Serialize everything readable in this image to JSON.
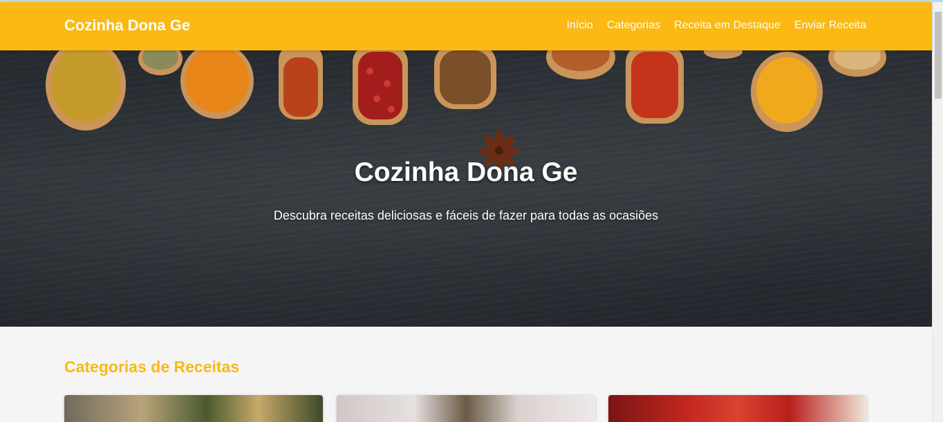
{
  "header": {
    "brand": "Cozinha Dona Ge",
    "nav": [
      "Início",
      "Categorias",
      "Receita em Destaque",
      "Enviar Receita"
    ]
  },
  "hero": {
    "title": "Cozinha Dona Ge",
    "subtitle": "Descubra receitas deliciosas e fáceis de fazer para todas as ocasiões"
  },
  "categories": {
    "title": "Categorias de Receitas"
  },
  "colors": {
    "accent": "#fdb913",
    "hero_bg": "#2b3035",
    "page_bg": "#f5f5f5"
  }
}
